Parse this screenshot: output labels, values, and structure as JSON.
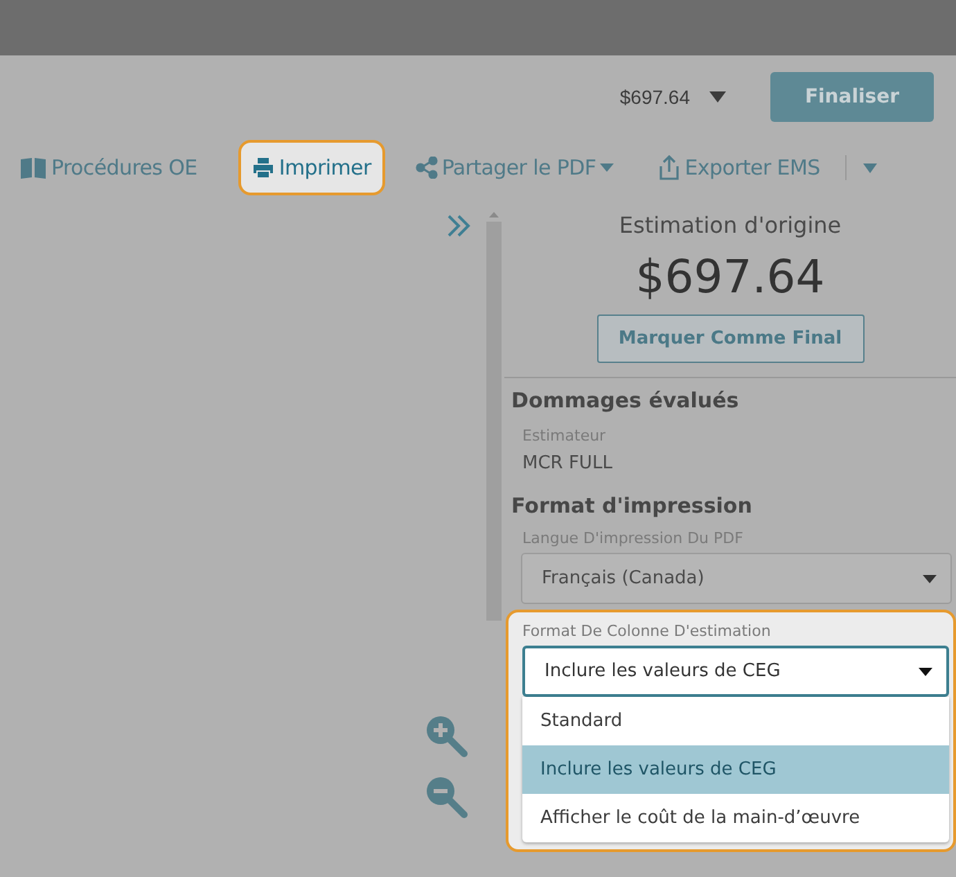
{
  "header": {
    "total": "$697.64",
    "finalize_button": "Finaliser"
  },
  "toolbar": [
    {
      "kind": "book",
      "label": "Procédures OE",
      "highlighted": false,
      "dropdown": false
    },
    {
      "kind": "printer",
      "label": "Imprimer",
      "highlighted": true,
      "dropdown": false
    },
    {
      "kind": "share",
      "label": "Partager le PDF",
      "highlighted": false,
      "dropdown": true
    },
    {
      "kind": "export",
      "label": "Exporter EMS",
      "highlighted": false,
      "dropdown": false
    }
  ],
  "panel": {
    "title": "Estimation d'origine",
    "amount": "$697.64",
    "mark_final_button": "Marquer Comme Final",
    "damage_heading": "Dommages évalués",
    "estimator_label": "Estimateur",
    "estimator_value": "MCR FULL",
    "print_heading": "Format d'impression",
    "language": {
      "label": "Langue D'impression Du PDF",
      "value": "Français (Canada)"
    },
    "column_format": {
      "label": "Format De Colonne D'estimation",
      "value": "Inclure les valeurs de CEG",
      "highlighted": true,
      "expanded": true,
      "options": [
        {
          "label": "Standard",
          "selected": false
        },
        {
          "label": "Inclure les valeurs de CEG",
          "selected": true
        },
        {
          "label": "Afficher le coût de la main-d’œuvre",
          "selected": false
        }
      ]
    }
  }
}
